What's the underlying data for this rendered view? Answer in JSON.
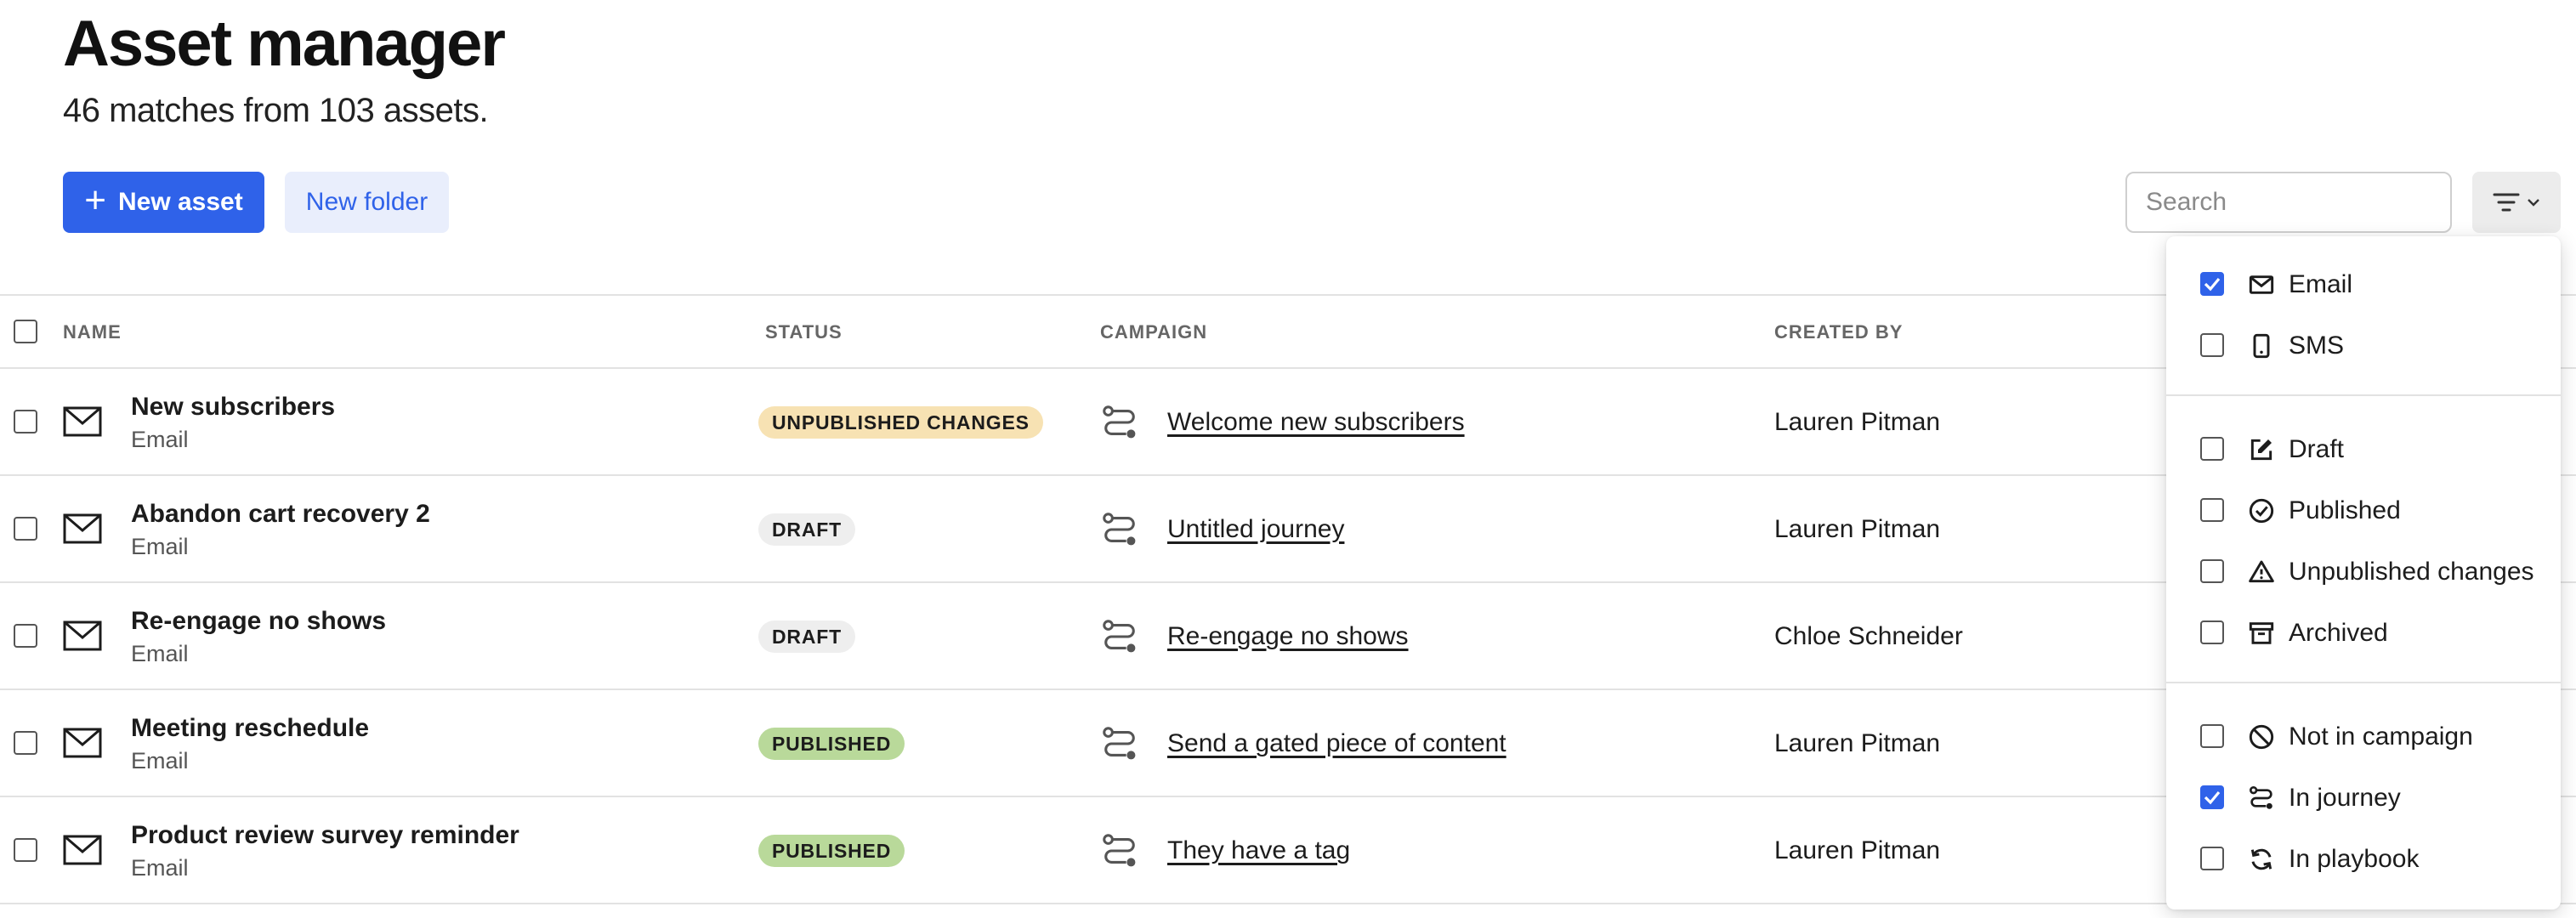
{
  "header": {
    "title": "Asset manager",
    "subtitle": "46 matches from 103 assets."
  },
  "toolbar": {
    "new_asset_label": "New asset",
    "new_folder_label": "New folder",
    "search_placeholder": "Search"
  },
  "colors": {
    "primary": "#2f62e9",
    "badge_unpublished": "#f7e2b3",
    "badge_draft": "#eeeeee",
    "badge_published": "#b9d99a"
  },
  "table": {
    "columns": [
      "NAME",
      "STATUS",
      "CAMPAIGN",
      "CREATED BY"
    ],
    "rows": [
      {
        "name": "New subscribers",
        "type": "Email",
        "status": "UNPUBLISHED CHANGES",
        "campaign": "Welcome new subscribers",
        "created_by": "Lauren Pitman"
      },
      {
        "name": "Abandon cart recovery 2",
        "type": "Email",
        "status": "DRAFT",
        "campaign": "Untitled journey",
        "created_by": "Lauren Pitman"
      },
      {
        "name": "Re-engage no shows",
        "type": "Email",
        "status": "DRAFT",
        "campaign": "Re-engage no shows",
        "created_by": "Chloe Schneider"
      },
      {
        "name": "Meeting reschedule",
        "type": "Email",
        "status": "PUBLISHED",
        "campaign": "Send a gated piece of content",
        "created_by": "Lauren Pitman"
      },
      {
        "name": "Product review survey reminder",
        "type": "Email",
        "status": "PUBLISHED",
        "campaign": "They have a tag",
        "created_by": "Lauren Pitman"
      }
    ]
  },
  "filter_menu": {
    "groups": [
      [
        {
          "label": "Email",
          "icon": "mail-icon",
          "checked": true
        },
        {
          "label": "SMS",
          "icon": "phone-icon",
          "checked": false
        }
      ],
      [
        {
          "label": "Draft",
          "icon": "edit-icon",
          "checked": false
        },
        {
          "label": "Published",
          "icon": "check-circle-icon",
          "checked": false
        },
        {
          "label": "Unpublished changes",
          "icon": "warning-icon",
          "checked": false
        },
        {
          "label": "Archived",
          "icon": "archive-icon",
          "checked": false
        }
      ],
      [
        {
          "label": "Not in campaign",
          "icon": "ban-icon",
          "checked": false
        },
        {
          "label": "In journey",
          "icon": "journey-icon",
          "checked": true
        },
        {
          "label": "In playbook",
          "icon": "refresh-icon",
          "checked": false
        }
      ]
    ]
  }
}
